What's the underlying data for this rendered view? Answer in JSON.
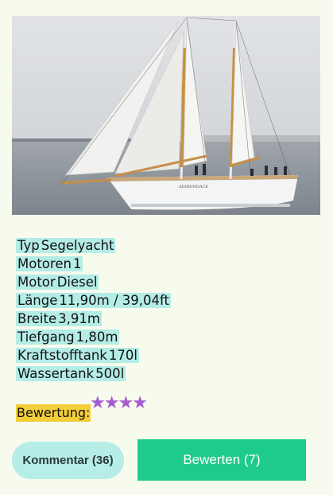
{
  "image": {
    "alt_icon": "sailing-yacht-photo",
    "hull_name": "ADIRONDACK"
  },
  "specs": [
    {
      "label": "Typ",
      "value": "Segelyacht"
    },
    {
      "label": "Motoren",
      "value": "1"
    },
    {
      "label": "Motor",
      "value": "Diesel"
    },
    {
      "label": "Länge",
      "value": "11,90m / 39,04ft"
    },
    {
      "label": "Breite",
      "value": "3,91m"
    },
    {
      "label": "Tiefgang",
      "value": "1,80m"
    },
    {
      "label": "Kraftstofftank",
      "value": "170l"
    },
    {
      "label": "Wassertank",
      "value": "500l"
    }
  ],
  "rating": {
    "label": "Bewertung:",
    "stars": 4,
    "star_glyph": "★",
    "star_color": "#a45ccf"
  },
  "buttons": {
    "comment": "Kommentar (36)",
    "rate": "Bewerten (7)"
  },
  "colors": {
    "highlight": "#b4ece6",
    "rating_highlight": "#f4ce3a",
    "primary": "#1fcb8a",
    "secondary": "#b6ede6",
    "background": "#f7fbee"
  }
}
